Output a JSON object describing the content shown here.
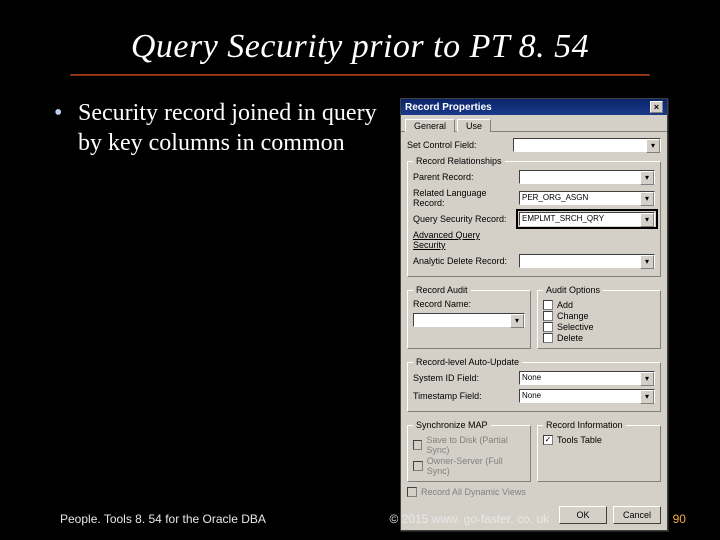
{
  "slide": {
    "title": "Query Security prior to PT 8. 54",
    "bullet": "Security record joined in query by key columns in common"
  },
  "dialog": {
    "title": "Record Properties",
    "close": "×",
    "tabs": [
      "General",
      "Use"
    ],
    "setControlField": {
      "label": "Set Control Field:",
      "value": ""
    },
    "relationships": {
      "legend": "Record Relationships",
      "rows": [
        {
          "label": "Parent Record:",
          "value": ""
        },
        {
          "label": "Related Language Record:",
          "value": "PER_ORG_ASGN"
        },
        {
          "label": "Query Security Record:",
          "value": "EMPLMT_SRCH_QRY"
        },
        {
          "label": "Advanced Query Security",
          "value": null
        },
        {
          "label": "Analytic Delete Record:",
          "value": ""
        }
      ]
    },
    "audit": {
      "legend": "Record Audit",
      "recordNameLabel": "Record Name:",
      "recordNameValue": "",
      "optionsLegend": "Audit Options",
      "options": [
        "Add",
        "Change",
        "Selective",
        "Delete"
      ]
    },
    "autoUpdate": {
      "legend": "Record-level Auto-Update",
      "rows": [
        {
          "label": "System ID Field:",
          "value": "None"
        },
        {
          "label": "Timestamp Field:",
          "value": "None"
        }
      ]
    },
    "sync": {
      "legend": "Synchronize MAP",
      "options": [
        "Save to Disk (Partial Sync)",
        "Owner-Server (Full Sync)"
      ]
    },
    "recordInfo": {
      "legend": "Record Information",
      "option": "Tools Table"
    },
    "persist": {
      "label": "Record All Dynamic Views",
      "checked": false
    },
    "buttons": {
      "ok": "OK",
      "cancel": "Cancel"
    }
  },
  "footer": {
    "left": "People. Tools 8. 54 for the Oracle DBA",
    "center": "© 2015 www. go-faster. co. uk",
    "page": "90"
  }
}
